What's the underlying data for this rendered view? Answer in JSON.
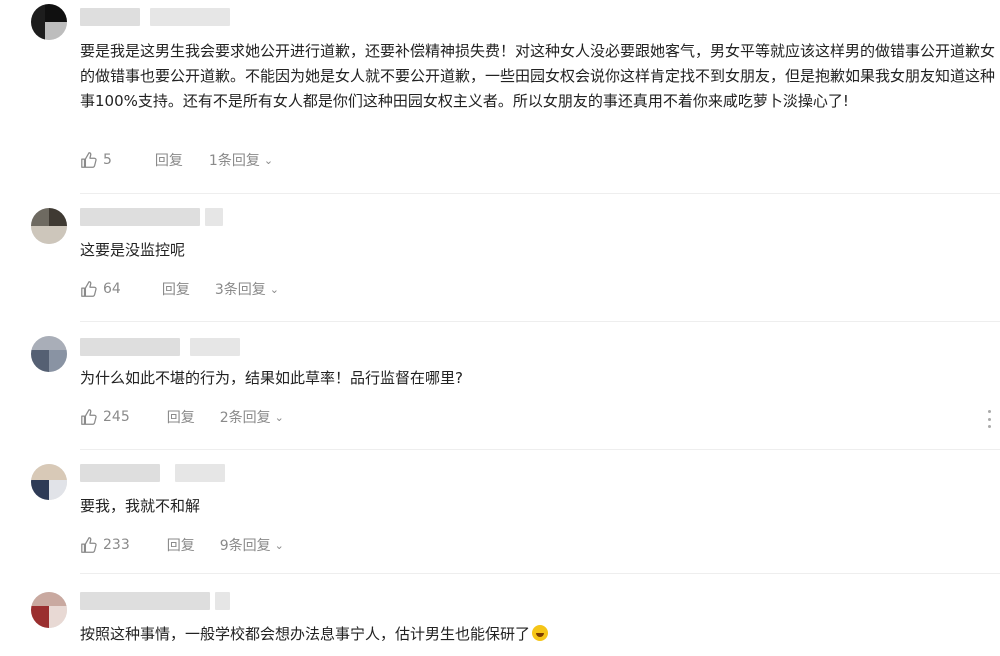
{
  "comments": [
    {
      "content": "要是我是这男生我会要求她公开进行道歉，还要补偿精神损失费！对这种女人没必要跟她客气，男女平等就应该这样男的做错事公开道歉女的做错事也要公开道歉。不能因为她是女人就不要公开道歉，一些田园女权会说你这样肯定找不到女朋友，但是抱歉如果我女朋友知道这种事100%支持。还有不是所有女人都是你们这种田园女权主义者。所以女朋友的事还真用不着你来咸吃萝卜淡操心了!",
      "likes": "5",
      "reply_label": "回复",
      "replies": "1条回复"
    },
    {
      "content": "这要是没监控呢",
      "likes": "64",
      "reply_label": "回复",
      "replies": "3条回复"
    },
    {
      "content": "为什么如此不堪的行为，结果如此草率！品行监督在哪里?",
      "likes": "245",
      "reply_label": "回复",
      "replies": "2条回复"
    },
    {
      "content": "要我，我就不和解",
      "likes": "233",
      "reply_label": "回复",
      "replies": "9条回复"
    },
    {
      "content": "按照这种事情，一般学校都会想办法息事宁人，估计男生也能保研了",
      "emoji": "rolling-laughing-emoji"
    }
  ],
  "icons": {
    "like": "thumbs-up-icon",
    "chevron": "chevron-down-icon",
    "more": "more-vertical-icon"
  },
  "colors": {
    "text": "#222222",
    "meta": "#8a8a8a",
    "divider": "#eeeeee"
  }
}
